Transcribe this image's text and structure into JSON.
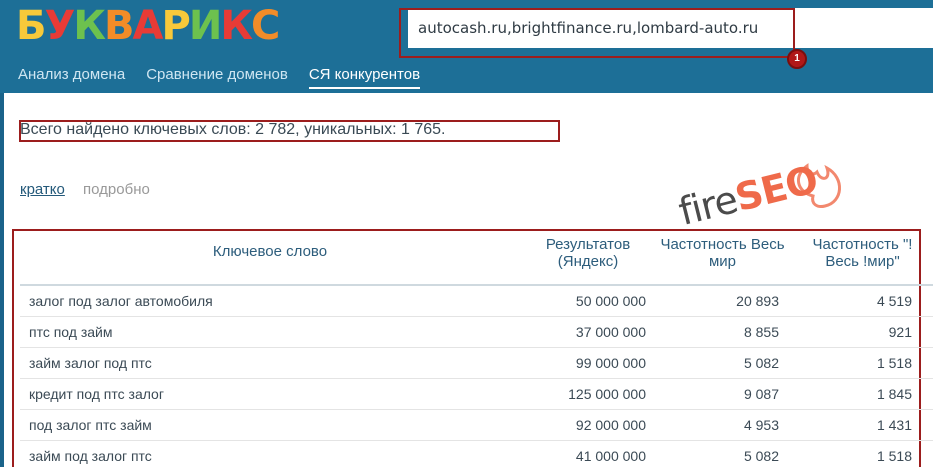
{
  "header": {
    "logo": {
      "text": "БУКВАРИКС",
      "letters": [
        {
          "char": "Б",
          "color": "#f7c93a"
        },
        {
          "char": "У",
          "color": "#e83b36"
        },
        {
          "char": "К",
          "color": "#6dc14e"
        },
        {
          "char": "В",
          "color": "#f28c28"
        },
        {
          "char": "А",
          "color": "#e83b36"
        },
        {
          "char": "Р",
          "color": "#f7c93a"
        },
        {
          "char": "И",
          "color": "#6dc14e"
        },
        {
          "char": "К",
          "color": "#e83b36"
        },
        {
          "char": "С",
          "color": "#f28c28"
        }
      ]
    },
    "search": {
      "value": "autocash.ru,brightfinance.ru,lombard-auto.ru"
    },
    "badge": "1",
    "tabs": [
      {
        "label": "Анализ домена",
        "active": false
      },
      {
        "label": "Сравнение доменов",
        "active": false
      },
      {
        "label": "СЯ конкурентов",
        "active": true
      }
    ]
  },
  "summary": "Всего найдено ключевых слов: 2 782, уникальных: 1 765.",
  "view_links": {
    "brief": "кратко",
    "detailed": "подробно"
  },
  "watermark": {
    "part1": "fire",
    "part2": "SEO"
  },
  "table": {
    "headers": {
      "keyword": "Ключевое слово",
      "results": "Результатов (Яндекс)",
      "freq_world": "Частотность Весь мир",
      "freq_exact": "Частотность \"!Весь !мир\""
    },
    "rows": [
      {
        "keyword": "залог под залог автомобиля",
        "results": "50 000 000",
        "freq_world": "20 893",
        "freq_exact": "4 519"
      },
      {
        "keyword": "птс под займ",
        "results": "37 000 000",
        "freq_world": "8 855",
        "freq_exact": "921"
      },
      {
        "keyword": "займ залог под птс",
        "results": "99 000 000",
        "freq_world": "5 082",
        "freq_exact": "1 518"
      },
      {
        "keyword": "кредит под птс залог",
        "results": "125 000 000",
        "freq_world": "9 087",
        "freq_exact": "1 845"
      },
      {
        "keyword": "под залог птс займ",
        "results": "92 000 000",
        "freq_world": "4 953",
        "freq_exact": "1 431"
      },
      {
        "keyword": "займ под залог птс",
        "results": "41 000 000",
        "freq_world": "5 082",
        "freq_exact": "1 518"
      }
    ]
  },
  "colors": {
    "header_bg": "#1d6f97",
    "highlight_border": "#9c1d1d",
    "link": "#24597a",
    "watermark_accent": "#ef6a4a"
  }
}
